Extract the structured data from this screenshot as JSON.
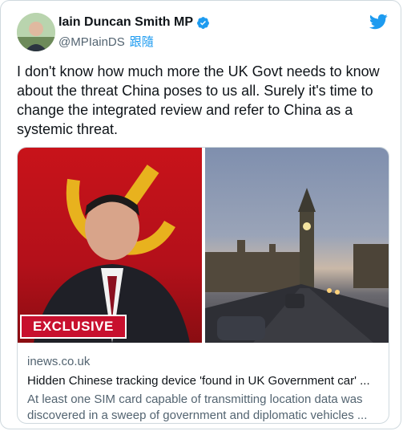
{
  "author": {
    "name": "Iain Duncan Smith MP",
    "handle": "@MPIainDS",
    "follow_label": "跟隨"
  },
  "tweet": {
    "text": "I don't know how much more the UK Govt needs to know about the threat China poses to us all. Surely it's time to change the integrated review and refer to China as a systemic threat."
  },
  "card": {
    "badge": "EXCLUSIVE",
    "domain": "inews.co.uk",
    "headline": "Hidden Chinese tracking device 'found in UK Government car' ...",
    "description": "At least one SIM card capable of transmitting location data was discovered in a sweep of government and diplomatic vehicles ..."
  },
  "colors": {
    "twitter_blue": "#1d9bf0",
    "badge_red": "#c8102e",
    "text_secondary": "#536471"
  },
  "icons": {
    "verified": "verified-badge-icon",
    "logo": "twitter-bird-icon"
  }
}
